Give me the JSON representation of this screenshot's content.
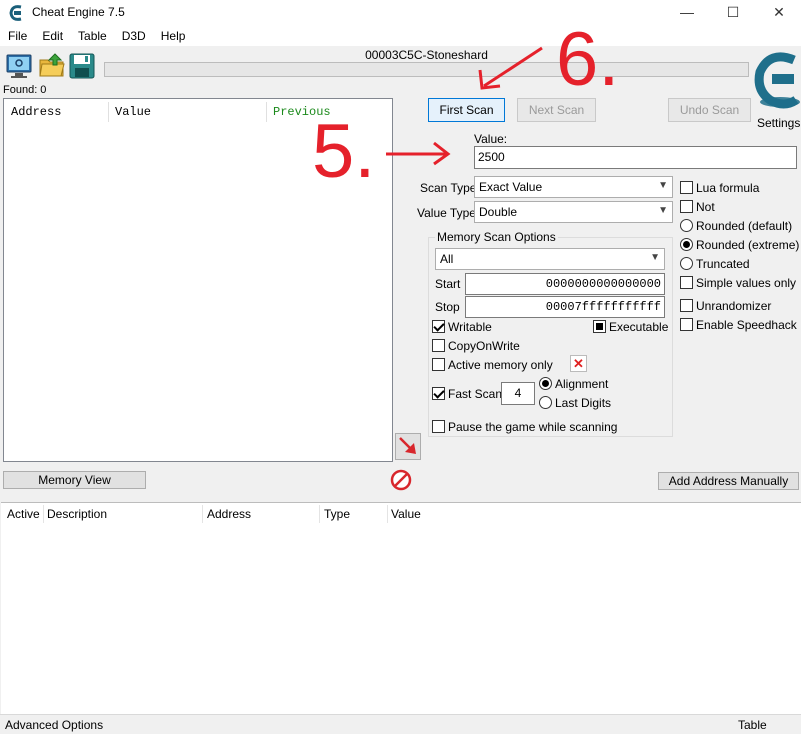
{
  "window": {
    "title": "Cheat Engine 7.5",
    "minimize_glyph": "—",
    "maximize_glyph": "☐",
    "close_glyph": "✕"
  },
  "menu": [
    "File",
    "Edit",
    "Table",
    "D3D",
    "Help"
  ],
  "toolbar": {
    "process_name": "00003C5C-Stoneshard",
    "settings_label": "Settings"
  },
  "results": {
    "found_label": "Found: 0",
    "columns": [
      "Address",
      "Value",
      "Previous"
    ]
  },
  "scan": {
    "first_scan": "First Scan",
    "next_scan": "Next Scan",
    "undo_scan": "Undo Scan",
    "value_label": "Value:",
    "value": "2500",
    "scan_type_label": "Scan Type",
    "scan_type": "Exact Value",
    "value_type_label": "Value Type",
    "value_type": "Double"
  },
  "memory_options": {
    "title": "Memory Scan Options",
    "region": "All",
    "start_label": "Start",
    "start": "0000000000000000",
    "stop_label": "Stop",
    "stop": "00007fffffffffff",
    "writable": "Writable",
    "executable": "Executable",
    "copy_on_write": "CopyOnWrite",
    "active_memory_only": "Active memory only",
    "fast_scan": "Fast Scan",
    "fast_scan_value": "4",
    "alignment": "Alignment",
    "last_digits": "Last Digits",
    "pause_game": "Pause the game while scanning"
  },
  "options": {
    "lua_formula": "Lua formula",
    "not": "Not",
    "rounded_default": "Rounded (default)",
    "rounded_extreme": "Rounded (extreme)",
    "truncated": "Truncated",
    "simple_values_only": "Simple values only",
    "unrandomizer": "Unrandomizer",
    "enable_speedhack": "Enable Speedhack"
  },
  "bottom": {
    "memory_view": "Memory View",
    "add_address_manually": "Add Address Manually",
    "columns": [
      "Active",
      "Description",
      "Address",
      "Type",
      "Value"
    ],
    "advanced_options": "Advanced Options",
    "table_extras": "Table Extras"
  },
  "annotations": {
    "step5": "5.",
    "step6": "6.",
    "color": "#e5212b"
  }
}
